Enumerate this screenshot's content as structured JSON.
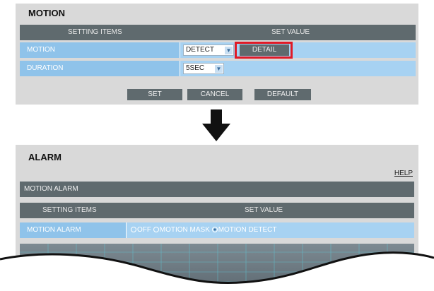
{
  "motion_panel": {
    "title": "MOTION",
    "headers": {
      "items": "SETTING ITEMS",
      "value": "SET VALUE"
    },
    "rows": [
      {
        "label": "MOTION",
        "select_value": "DETECT",
        "detail_label": "DETAIL"
      },
      {
        "label": "DURATION",
        "select_value": "5SEC"
      }
    ],
    "actions": {
      "set": "SET",
      "cancel": "CANCEL",
      "default": "DEFAULT"
    }
  },
  "alarm_panel": {
    "title": "ALARM",
    "help": "HELP",
    "section": "MOTION ALARM",
    "headers": {
      "items": "SETTING ITEMS",
      "value": "SET VALUE"
    },
    "row": {
      "label": "MOTION ALARM",
      "options": [
        "OFF",
        "MOTION MASK",
        "MOTION DETECT"
      ],
      "selected": "MOTION DETECT"
    }
  },
  "colors": {
    "panel_bg": "#d9d9d9",
    "header_dark": "#5f6a6e",
    "row_label_bg": "#8fc3ea",
    "row_value_bg": "#a7d2f2",
    "highlight": "#e01a26"
  },
  "icons": {
    "arrow": "arrow-down-icon",
    "chevron": "chevron-down-icon"
  }
}
